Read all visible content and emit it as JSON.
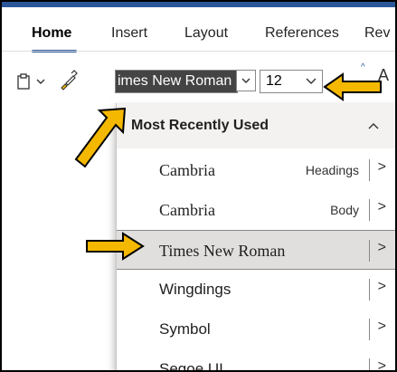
{
  "tabs": [
    "Home",
    "Insert",
    "Layout",
    "References",
    "Rev"
  ],
  "ribbon": {
    "font_name": "imes New Roman",
    "font_size": "12"
  },
  "dropdown": {
    "section_title": "Most Recently Used",
    "items": [
      {
        "name": "Cambria",
        "tag": "Headings"
      },
      {
        "name": "Cambria",
        "tag": "Body"
      },
      {
        "name": "Times New Roman",
        "tag": ""
      },
      {
        "name": "Wingdings",
        "tag": ""
      },
      {
        "name": "Symbol",
        "tag": ""
      },
      {
        "name": "Segoe UI",
        "tag": ""
      }
    ]
  },
  "colors": {
    "accent": "#2b579a",
    "arrow_fill": "#f5b800",
    "selected_font_bg": "#444444"
  },
  "icons": [
    "clipboard-icon",
    "format-painter-icon",
    "chevron-down-icon",
    "chevron-up-icon",
    "chevron-right-icon"
  ]
}
